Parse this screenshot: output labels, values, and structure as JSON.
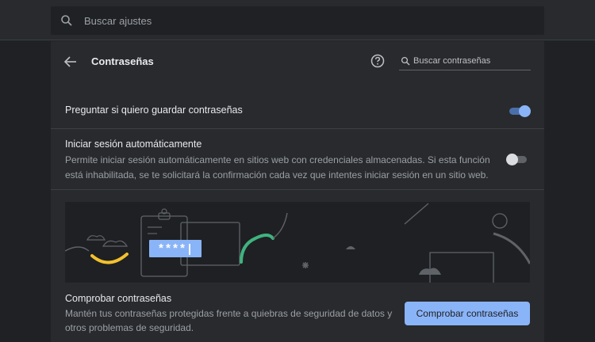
{
  "settings_search": {
    "placeholder": "Buscar ajustes",
    "icon": "search-icon"
  },
  "header": {
    "title": "Contraseñas",
    "back_icon": "arrow-back-icon",
    "help_icon": "help-icon",
    "password_search_placeholder": "Buscar contraseñas"
  },
  "offer_to_save": {
    "label": "Preguntar si quiero guardar contraseñas",
    "enabled": true
  },
  "auto_signin": {
    "label": "Iniciar sesión automáticamente",
    "description": "Permite iniciar sesión automáticamente en sitios web con credenciales almacenadas. Si esta función está inhabilitada, se te solicitará la confirmación cada vez que intentes iniciar sesión en un sitio web.",
    "enabled": false
  },
  "illustration": {
    "password_mask": "****|"
  },
  "check_passwords": {
    "title": "Comprobar contraseñas",
    "description": "Mantén tus contraseñas protegidas frente a quiebras de seguridad de datos y otros problemas de seguridad.",
    "button_label": "Comprobar contraseñas"
  },
  "colors": {
    "accent": "#8ab4f8",
    "background": "#202124",
    "card": "#292a2d"
  }
}
